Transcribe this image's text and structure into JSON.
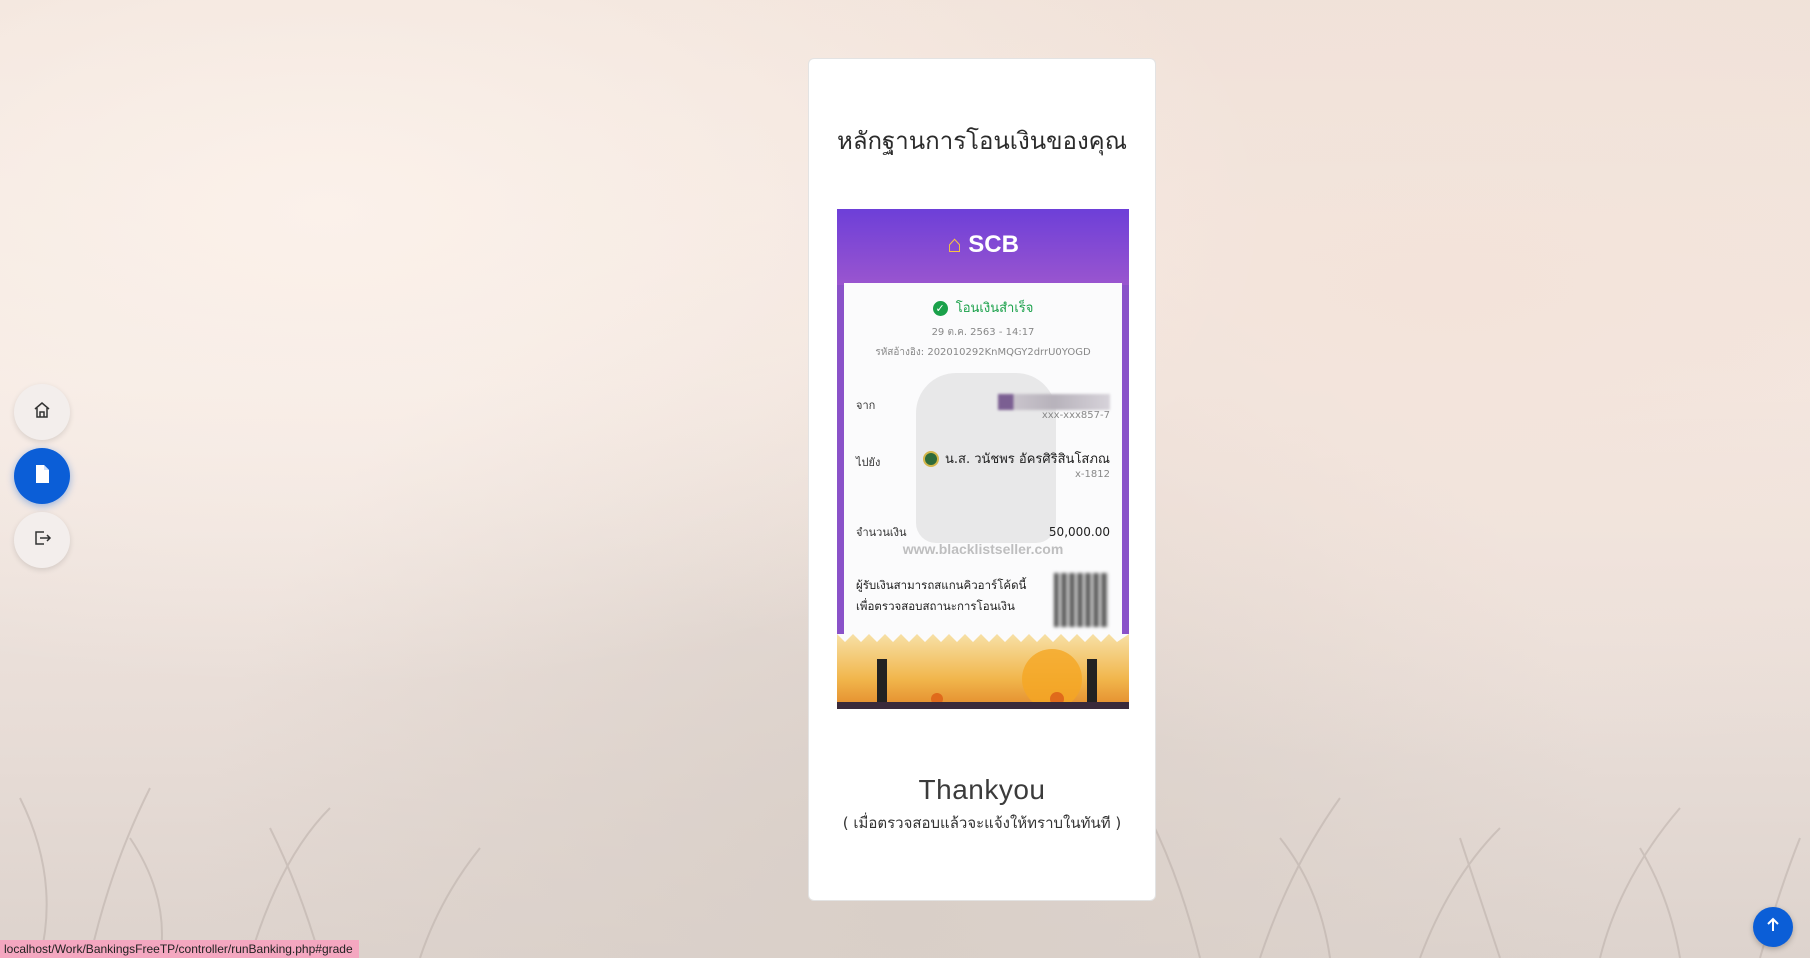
{
  "sidebar": {
    "items": [
      {
        "icon": "home-icon",
        "active": false
      },
      {
        "icon": "document-icon",
        "active": true
      },
      {
        "icon": "logout-icon",
        "active": false
      }
    ]
  },
  "card": {
    "title": "หลักฐานการโอนเงินของคุณ",
    "thank_you": "Thankyou",
    "subtitle": "( เมื่อตรวจสอบแล้วจะแจ้งให้ทราบในทันที )"
  },
  "slip": {
    "bank": "SCB",
    "status": "โอนเงินสำเร็จ",
    "datetime": "29 ต.ค. 2563 - 14:17",
    "reference": "รหัสอ้างอิง: 202010292KnMQGY2drrU0YOGD",
    "from_label": "จาก",
    "from_account": "xxx-xxx857-7",
    "to_label": "ไปยัง",
    "to_name": "น.ส. วนัชพร อัครศิริสินโสภณ",
    "to_account": "x-1812",
    "amount_label": "จำนวนเงิน",
    "amount": "50,000.00",
    "watermark": "www.blacklistseller.com",
    "qr_line1": "ผู้รับเงินสามารถสแกนคิวอาร์โค้ดนี้",
    "qr_line2": "เพื่อตรวจสอบสถานะการโอนเงิน"
  },
  "status_bar": {
    "url": "localhost/Work/BankingsFreeTP/controller/runBanking.php#grade"
  },
  "colors": {
    "primary": "#0b5ed7",
    "scb_purple": "#6d3fd8",
    "success": "#1aa14a"
  }
}
